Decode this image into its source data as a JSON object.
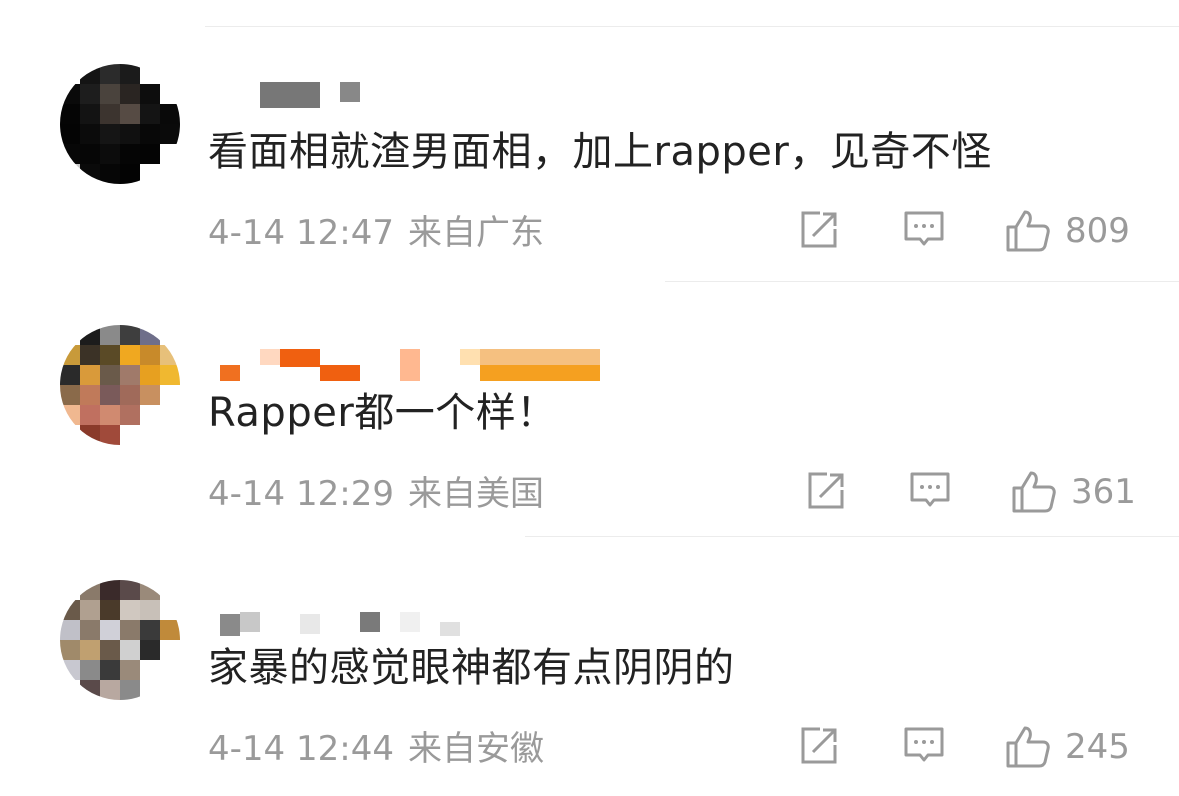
{
  "comments": [
    {
      "text": "看面相就渣男面相，加上rapper，见奇不怪",
      "date": "4-14 12:47",
      "location": "来自广东",
      "likes": "809",
      "avatar_colors": [
        "#ffffff",
        "#141414",
        "#2b2b2b",
        "#1b1b1b",
        "#ffffff",
        "#ffffff",
        "#0a0a0a",
        "#1d1d1d",
        "#4a433d",
        "#2a2522",
        "#0d0d0d",
        "#ffffff",
        "#050505",
        "#131313",
        "#3c342f",
        "#564b44",
        "#141414",
        "#090909",
        "#040404",
        "#0b0b0b",
        "#151515",
        "#101010",
        "#080808",
        "#0a0a0a",
        "#070707",
        "#060606",
        "#0c0c0c",
        "#050505",
        "#040404",
        "#ffffff",
        "#c9c9c9",
        "#0a0a0a",
        "#060606",
        "#030303",
        "#ffffff",
        "#ffffff"
      ],
      "name_colors": [
        "#777777",
        "#888888"
      ]
    },
    {
      "text": "Rapper都一个样！",
      "date": "4-14 12:29",
      "location": "来自美国",
      "likes": "361",
      "avatar_colors": [
        "#ffffff",
        "#1c1c1c",
        "#8a8a8a",
        "#3e3e3e",
        "#6e6e8a",
        "#ffffff",
        "#c89a3a",
        "#3b3226",
        "#5a4a26",
        "#f0a820",
        "#c88a2a",
        "#e7c07a",
        "#2a2a2a",
        "#d99a3a",
        "#6a5a4a",
        "#a07a6a",
        "#e7a020",
        "#f0b830",
        "#8a6a4a",
        "#c07a5a",
        "#7a5a5a",
        "#a06a5a",
        "#c89060",
        "#ffffff",
        "#f0b890",
        "#c07060",
        "#d08a70",
        "#b07060",
        "#ffffff",
        "#ffffff",
        "#ffffff",
        "#8a3a2a",
        "#a04a3a",
        "#ffffff",
        "#ffffff",
        "#ffffff"
      ],
      "name_colors": [
        "#f07020",
        "#ffd8c0",
        "#f06010",
        "#ffb890",
        "#f5c080",
        "#ffe0b0",
        "#f5a020",
        "#ffd060"
      ]
    },
    {
      "text": "家暴的感觉眼神都有点阴阴的",
      "date": "4-14 12:44",
      "location": "来自安徽",
      "likes": "245",
      "avatar_colors": [
        "#ffffff",
        "#8a7a6a",
        "#3a2a2a",
        "#5a4a4a",
        "#9a8a7a",
        "#ffffff",
        "#6a5a4a",
        "#b0a090",
        "#4a3a2a",
        "#d0c8c0",
        "#c8c0b8",
        "#ffffff",
        "#c0c0c8",
        "#8a7a6a",
        "#d0d0d8",
        "#8a7a6a",
        "#3a3a3a",
        "#c08a3a",
        "#a08a6a",
        "#c0a070",
        "#6a5a4a",
        "#d0d0d0",
        "#2a2a2a",
        "#ffffff",
        "#c8c8d0",
        "#8a8a8a",
        "#3a3a3a",
        "#9a8a7a",
        "#ffffff",
        "#ffffff",
        "#ffffff",
        "#5a4a4a",
        "#b8a8a0",
        "#8a8a8a",
        "#ffffff",
        "#ffffff"
      ],
      "name_colors": [
        "#8a8a8a",
        "#c8c8c8",
        "#e8e8e8",
        "#7a7a7a",
        "#f0f0f0",
        "#e0e0e0"
      ]
    }
  ],
  "icons": {
    "share": "share-icon",
    "comment": "comment-icon",
    "like": "thumbs-up-icon"
  },
  "colors": {
    "text": "#222222",
    "meta": "#9a9a9a",
    "icon": "#9a9a9a",
    "divider": "#ececec"
  }
}
